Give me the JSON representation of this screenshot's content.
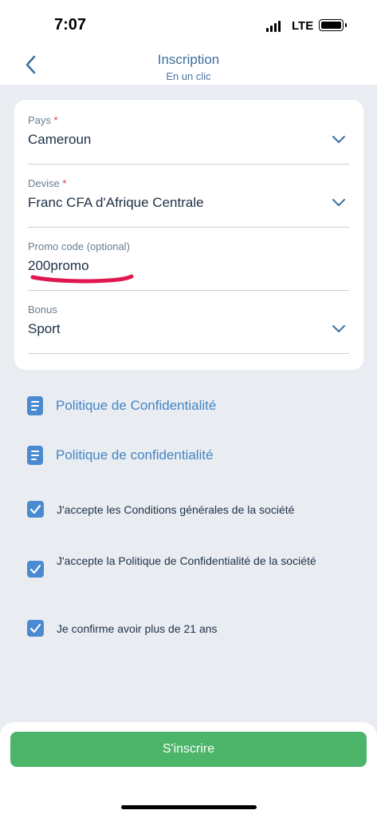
{
  "status_bar": {
    "time": "7:07",
    "network": "LTE"
  },
  "header": {
    "title": "Inscription",
    "subtitle": "En un clic",
    "back_icon": "chevron-left-icon"
  },
  "form": {
    "country": {
      "label": "Pays",
      "required_mark": "*",
      "value": "Cameroun"
    },
    "currency": {
      "label": "Devise",
      "required_mark": "*",
      "value": "Franc CFA d'Afrique Centrale"
    },
    "promo": {
      "label": "Promo code (optional)",
      "value": "200promo"
    },
    "bonus": {
      "label": "Bonus",
      "value": "Sport"
    }
  },
  "links": [
    {
      "label": "Politique de Confidentialité",
      "icon": "document-icon"
    },
    {
      "label": "Politique de confidentialité",
      "icon": "document-icon"
    }
  ],
  "checkboxes": [
    {
      "label": "J'accepte les Conditions générales de la société",
      "checked": true
    },
    {
      "label": "J'accepte la Politique de Confidentialité de la société",
      "checked": true
    },
    {
      "label": "Je confirme avoir plus de 21 ans",
      "checked": true
    }
  ],
  "submit_label": "S'inscrire",
  "colors": {
    "accent_blue": "#4a8ad1",
    "link_blue": "#4585c4",
    "submit_green": "#4cb569",
    "required_red": "#e0343f",
    "annotation_red": "#e0174f",
    "background": "#e9edf2"
  }
}
